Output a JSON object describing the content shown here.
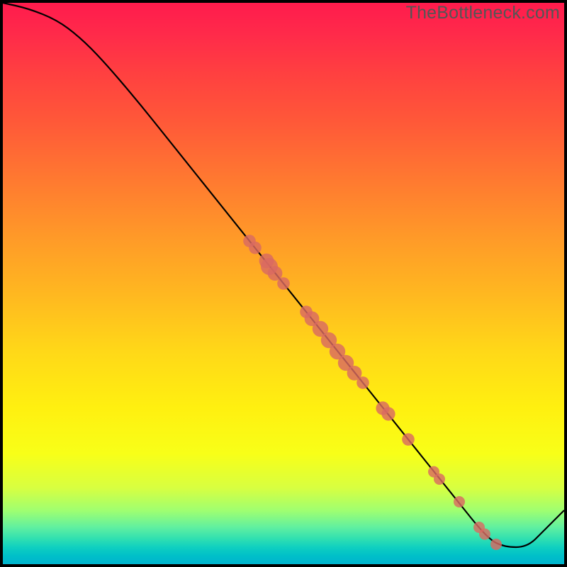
{
  "watermark": "TheBottleneck.com",
  "chart_data": {
    "type": "line",
    "title": "",
    "xlabel": "",
    "ylabel": "",
    "xlim": [
      0,
      100
    ],
    "ylim": [
      0,
      100
    ],
    "curve": [
      {
        "x": 0.5,
        "y": 99.5
      },
      {
        "x": 5,
        "y": 98.5
      },
      {
        "x": 10,
        "y": 96.5
      },
      {
        "x": 14,
        "y": 93.5
      },
      {
        "x": 18,
        "y": 89.5
      },
      {
        "x": 24,
        "y": 82.5
      },
      {
        "x": 30,
        "y": 75.0
      },
      {
        "x": 40,
        "y": 62.5
      },
      {
        "x": 50,
        "y": 50.0
      },
      {
        "x": 60,
        "y": 37.5
      },
      {
        "x": 70,
        "y": 25.0
      },
      {
        "x": 80,
        "y": 12.5
      },
      {
        "x": 86,
        "y": 5.0
      },
      {
        "x": 89,
        "y": 3.5
      },
      {
        "x": 93,
        "y": 3.5
      },
      {
        "x": 96,
        "y": 6.5
      },
      {
        "x": 99.5,
        "y": 10.0
      }
    ],
    "markers": [
      {
        "x": 44.0,
        "y": 57.5,
        "r": 1.1
      },
      {
        "x": 45.0,
        "y": 56.3,
        "r": 1.1
      },
      {
        "x": 47.0,
        "y": 54.0,
        "r": 1.3
      },
      {
        "x": 47.5,
        "y": 53.0,
        "r": 1.5
      },
      {
        "x": 48.5,
        "y": 51.8,
        "r": 1.3
      },
      {
        "x": 50.0,
        "y": 50.0,
        "r": 1.1
      },
      {
        "x": 54.0,
        "y": 45.0,
        "r": 1.1
      },
      {
        "x": 55.0,
        "y": 43.8,
        "r": 1.3
      },
      {
        "x": 56.5,
        "y": 42.0,
        "r": 1.4
      },
      {
        "x": 58.0,
        "y": 40.0,
        "r": 1.4
      },
      {
        "x": 59.5,
        "y": 38.0,
        "r": 1.4
      },
      {
        "x": 61.0,
        "y": 36.0,
        "r": 1.4
      },
      {
        "x": 62.5,
        "y": 34.2,
        "r": 1.3
      },
      {
        "x": 64.0,
        "y": 32.5,
        "r": 1.1
      },
      {
        "x": 67.5,
        "y": 28.0,
        "r": 1.2
      },
      {
        "x": 68.5,
        "y": 27.0,
        "r": 1.2
      },
      {
        "x": 72.0,
        "y": 22.5,
        "r": 1.1
      },
      {
        "x": 76.5,
        "y": 16.8,
        "r": 1.0
      },
      {
        "x": 77.5,
        "y": 15.5,
        "r": 1.0
      },
      {
        "x": 81.0,
        "y": 11.5,
        "r": 1.0
      },
      {
        "x": 84.5,
        "y": 7.0,
        "r": 1.0
      },
      {
        "x": 85.5,
        "y": 5.8,
        "r": 1.0
      },
      {
        "x": 87.5,
        "y": 4.0,
        "r": 1.0
      }
    ]
  }
}
